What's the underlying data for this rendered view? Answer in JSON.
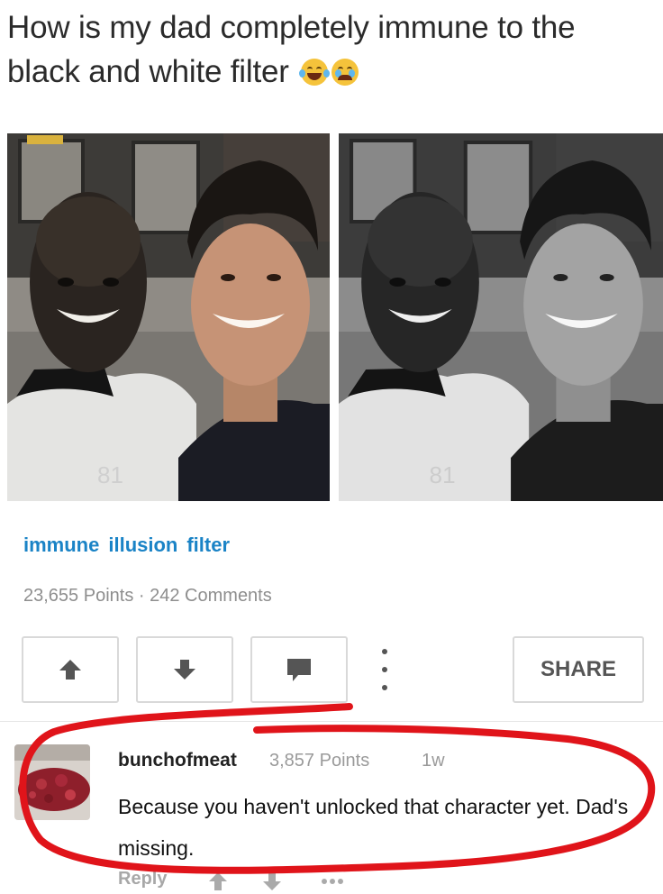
{
  "post": {
    "title": "How is my dad completely immune to the black and white filter",
    "emojis": [
      "laughing-tears-emoji",
      "crying-emoji"
    ],
    "tags": [
      "immune",
      "illusion",
      "filter"
    ],
    "points": "23,655 Points",
    "separator": "·",
    "comments": "242 Comments",
    "share_label": "SHARE"
  },
  "comment": {
    "username": "bunchofmeat",
    "points": "3,857 Points",
    "age": "1w",
    "text": "Because you haven't unlocked that character yet. Dad's missing.",
    "reply_label": "Reply"
  },
  "photo": {
    "shirt_text": "81"
  },
  "colors": {
    "tag_blue": "#1a83c6",
    "annotation_red": "#e0141a",
    "meta_gray": "#8e8e8e"
  }
}
